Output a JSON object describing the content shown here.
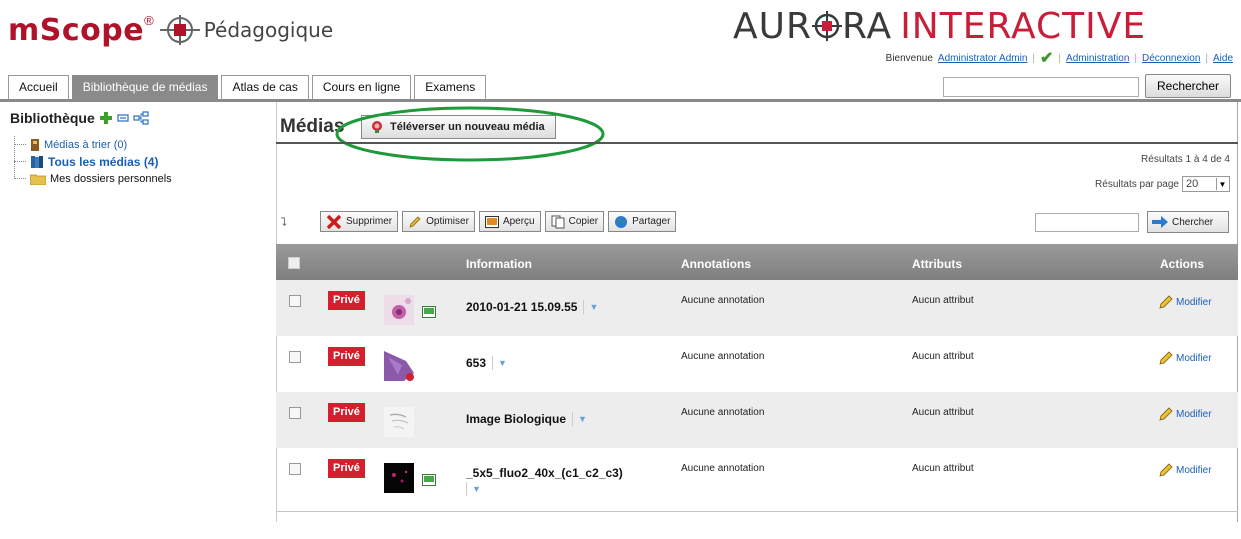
{
  "header": {
    "logo_brand": "mScope",
    "logo_reg": "®",
    "logo_sub": "Pédagogique",
    "aurora_left": "AUR",
    "aurora_mid": "RA",
    "aurora_right": "INTERACTIVE",
    "welcome": "Bienvenue",
    "user_link": "Administrator Admin",
    "admin_link": "Administration",
    "logout_link": "Déconnexion",
    "help_link": "Aide",
    "search_button": "Rechercher"
  },
  "tabs": [
    {
      "label": "Accueil",
      "active": false
    },
    {
      "label": "Bibliothèque de médias",
      "active": true
    },
    {
      "label": "Atlas de cas",
      "active": false
    },
    {
      "label": "Cours en ligne",
      "active": false
    },
    {
      "label": "Examens",
      "active": false
    }
  ],
  "sidebar": {
    "title": "Bibliothèque",
    "items": [
      {
        "label": "Médias à trier (0)",
        "style": "link"
      },
      {
        "label": "Tous les médias (4)",
        "style": "bold-link"
      },
      {
        "label": "Mes dossiers personnels",
        "style": "plain"
      }
    ]
  },
  "main": {
    "title": "Médias",
    "upload_button": "Téléverser un nouveau média",
    "results_text": "Résultats 1 à 4 de 4",
    "per_page_label": "Résultats par page",
    "per_page_value": "20",
    "toolbar": {
      "delete": "Supprimer",
      "optimize": "Optimiser",
      "preview": "Aperçu",
      "copy": "Copier",
      "share": "Partager",
      "search_button": "Chercher"
    },
    "columns": {
      "information": "Information",
      "annotations": "Annotations",
      "attributes": "Attributs",
      "actions": "Actions"
    },
    "rows": [
      {
        "badge": "Privé",
        "name": "2010-01-21 15.09.55",
        "annotations": "Aucune annotation",
        "attributes": "Aucun attribut",
        "action": "Modifier",
        "has_image_icon": true
      },
      {
        "badge": "Privé",
        "name": "653",
        "annotations": "Aucune annotation",
        "attributes": "Aucun attribut",
        "action": "Modifier",
        "has_image_icon": false
      },
      {
        "badge": "Privé",
        "name": "Image Biologique",
        "annotations": "Aucune annotation",
        "attributes": "Aucun attribut",
        "action": "Modifier",
        "has_image_icon": false
      },
      {
        "badge": "Privé",
        "name": "_5x5_fluo2_40x_(c1_c2_c3)",
        "annotations": "Aucune annotation",
        "attributes": "Aucun attribut",
        "action": "Modifier",
        "has_image_icon": true
      }
    ]
  },
  "colors": {
    "brand_red": "#b0122a",
    "badge_red": "#d4202e",
    "tab_active": "#8a8a8a",
    "link_blue": "#1a5fb4",
    "highlight_green": "#1e9a3a"
  }
}
